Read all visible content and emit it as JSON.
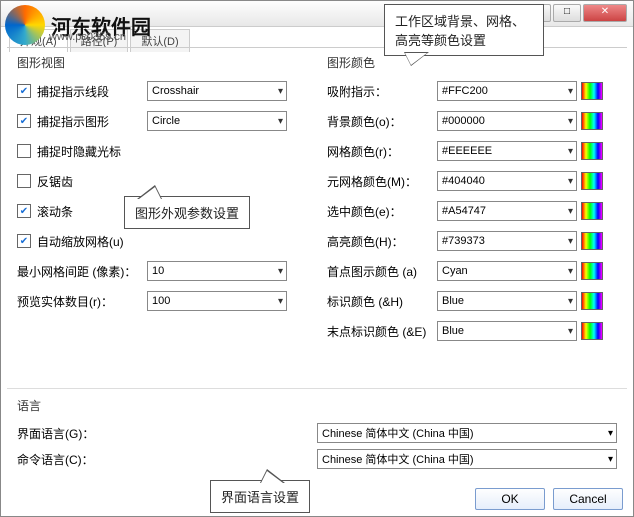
{
  "watermark": {
    "title": "河东软件园",
    "url": "www.pc0359.cn"
  },
  "titlebar": {
    "min": "—",
    "max": "□",
    "close": "✕"
  },
  "tabs": [
    "外观(A)",
    "路径(P)",
    "默认(D)"
  ],
  "group_left_title": "图形视图",
  "group_right_title": "图形颜色",
  "left": {
    "crosshair_chk": true,
    "crosshair_label": "捕捉指示线段",
    "crosshair_value": "Crosshair",
    "circle_chk": true,
    "circle_label": "捕捉指示图形",
    "circle_value": "Circle",
    "hidecursor_chk": false,
    "hidecursor_label": "捕捉时隐藏光标",
    "antialias_chk": false,
    "antialias_label": "反锯齿",
    "scrollbar_chk": true,
    "scrollbar_label": "滚动条",
    "autoscale_chk": true,
    "autoscale_label": "自动缩放网格(u)",
    "mingrid_label": "最小网格间距 (像素)：",
    "mingrid_value": "10",
    "preview_label": "预览实体数目(r)：",
    "preview_value": "100"
  },
  "right": [
    {
      "label": "吸附指示：",
      "value": "#FFC200"
    },
    {
      "label": "背景颜色(o)：",
      "value": "#000000"
    },
    {
      "label": "网格颜色(r)：",
      "value": "#EEEEEE"
    },
    {
      "label": "元网格颜色(M)：",
      "value": "#404040"
    },
    {
      "label": "选中颜色(e)：",
      "value": "#A54747"
    },
    {
      "label": "高亮颜色(H)：",
      "value": "#739373"
    },
    {
      "label": "首点图示颜色 (a)",
      "value": "Cyan"
    },
    {
      "label": "标识颜色 (&H)",
      "value": "Blue"
    },
    {
      "label": "末点标识颜色 (&E)",
      "value": "Blue"
    }
  ],
  "lang": {
    "section_title": "语言",
    "gui_label": "界面语言(G)：",
    "gui_value": "Chinese 简体中文 (China 中国)",
    "cmd_label": "命令语言(C)：",
    "cmd_value": "Chinese 简体中文 (China 中国)"
  },
  "buttons": {
    "ok": "OK",
    "cancel": "Cancel"
  },
  "callouts": {
    "c1": "工作区域背景、网格、高亮等颜色设置",
    "c2": "图形外观参数设置",
    "c3": "界面语言设置"
  }
}
